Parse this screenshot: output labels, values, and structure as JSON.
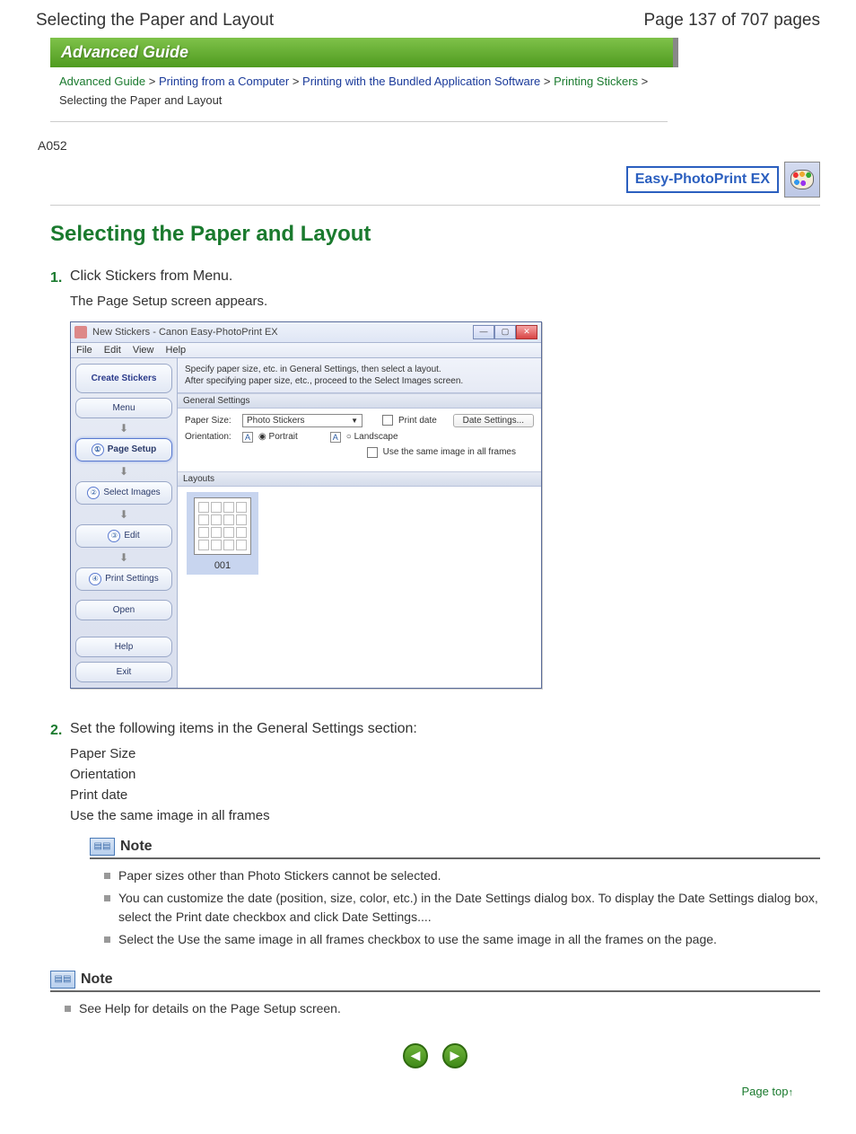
{
  "header": {
    "title": "Selecting the Paper and Layout",
    "page_label": "Page 137 of 707 pages"
  },
  "banner": "Advanced Guide",
  "breadcrumb": {
    "c1": "Advanced Guide",
    "c2": "Printing from a Computer",
    "c3": "Printing with the Bundled Application Software",
    "c4": "Printing Stickers",
    "current": "Selecting the Paper and Layout",
    "sep": " > "
  },
  "doc_code": "A052",
  "logo_text": "Easy-PhotoPrint EX",
  "main_heading": "Selecting the Paper and Layout",
  "steps": {
    "s1": {
      "num": "1.",
      "title": "Click Stickers from Menu.",
      "sub": "The Page Setup screen appears."
    },
    "s2": {
      "num": "2.",
      "title": "Set the following items in the General Settings section:",
      "items": [
        "Paper Size",
        "Orientation",
        "Print date",
        "Use the same image in all frames"
      ]
    }
  },
  "app": {
    "title": "New Stickers - Canon Easy-PhotoPrint EX",
    "menus": [
      "File",
      "Edit",
      "View",
      "Help"
    ],
    "sidebar": {
      "top": "Create Stickers",
      "menu": "Menu",
      "steps": [
        {
          "n": "①",
          "label": "Page Setup"
        },
        {
          "n": "②",
          "label": "Select Images"
        },
        {
          "n": "③",
          "label": "Edit"
        },
        {
          "n": "④",
          "label": "Print Settings"
        }
      ],
      "open": "Open",
      "help": "Help",
      "exit": "Exit"
    },
    "instr1": "Specify paper size, etc. in General Settings, then select a layout.",
    "instr2": "After specifying paper size, etc., proceed to the Select Images screen.",
    "gs_header": "General Settings",
    "paper_size_label": "Paper Size:",
    "paper_size_value": "Photo Stickers",
    "orientation_label": "Orientation:",
    "portrait": "Portrait",
    "landscape": "Landscape",
    "print_date": "Print date",
    "date_settings": "Date Settings...",
    "same_image": "Use the same image in all frames",
    "layouts_header": "Layouts",
    "thumb_label": "001"
  },
  "notes": {
    "title": "Note",
    "inner": [
      "Paper sizes other than Photo Stickers cannot be selected.",
      "You can customize the date (position, size, color, etc.) in the Date Settings dialog box. To display the Date Settings dialog box, select the Print date checkbox and click Date Settings....",
      "Select the Use the same image in all frames checkbox to use the same image in all the frames on the page."
    ],
    "outer": [
      "See Help for details on the Page Setup screen."
    ]
  },
  "page_top": "Page top"
}
